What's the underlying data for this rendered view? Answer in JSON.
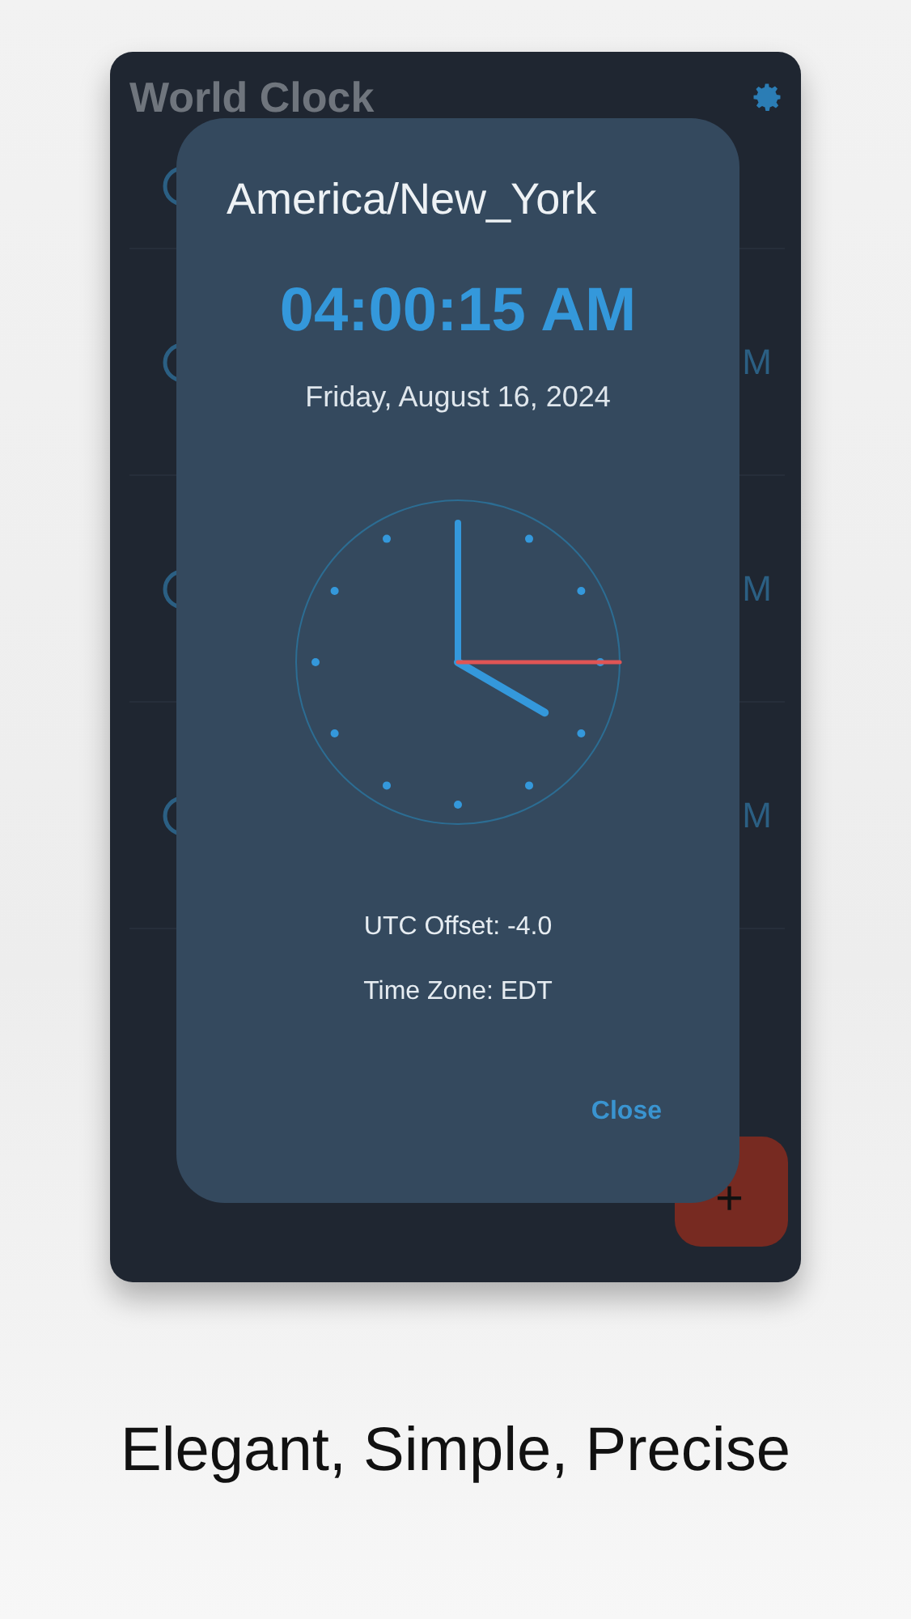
{
  "app": {
    "title": "World Clock"
  },
  "background_rows": [
    {
      "time_fragment": null
    },
    {
      "time_fragment": "M"
    },
    {
      "time_fragment": "M"
    },
    {
      "time_fragment": "M"
    }
  ],
  "dialog": {
    "zone": "America/New_York",
    "time": "04:00:15 AM",
    "date": "Friday, August 16, 2024",
    "utc_offset": "UTC Offset: -4.0",
    "time_zone": "Time Zone: EDT",
    "close": "Close"
  },
  "fab": {
    "label": "+"
  },
  "caption": "Elegant, Simple, Precise"
}
